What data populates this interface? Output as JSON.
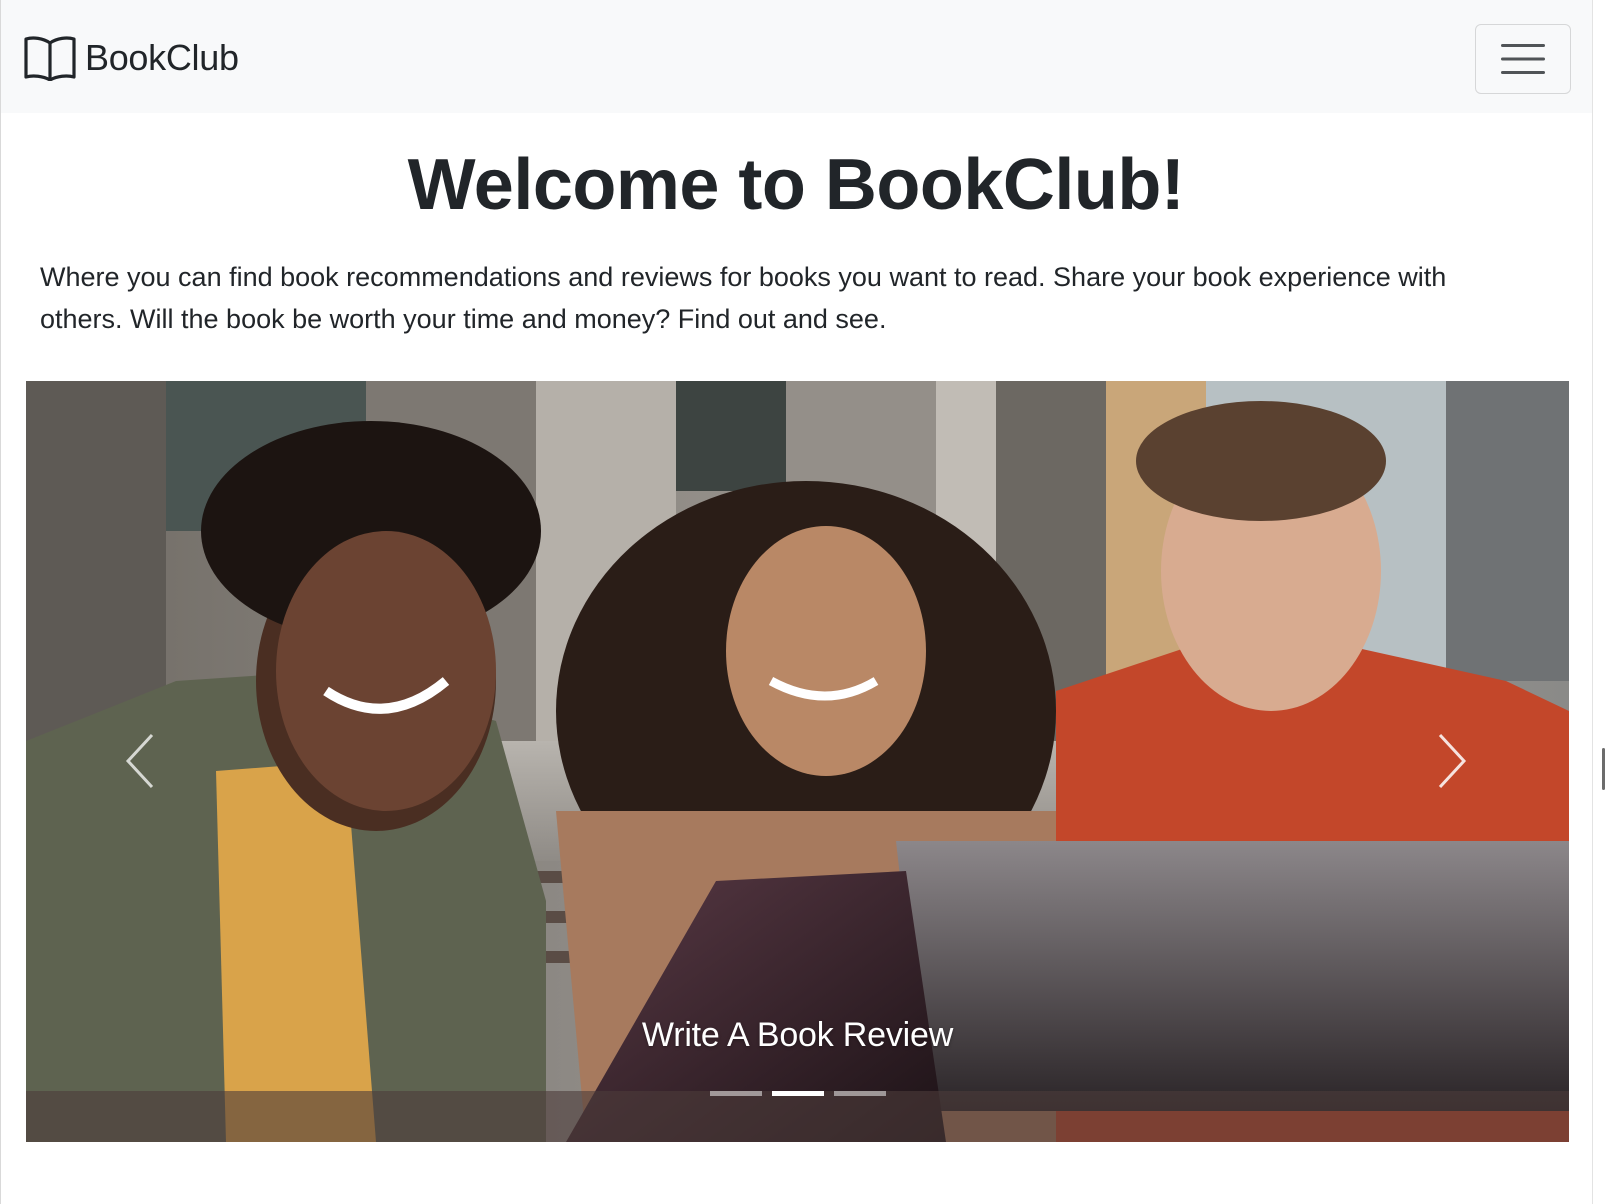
{
  "navbar": {
    "brand_icon": "book-open-icon",
    "brand_name": "BookClub",
    "toggler_icon": "hamburger-menu-icon"
  },
  "hero": {
    "title": "Welcome to BookClub!",
    "lead": "Where you can find book recommendations and reviews for books you want to read. Share your book experience with others. Will the book be worth your time and money? Find out and see."
  },
  "carousel": {
    "prev_icon": "chevron-left-icon",
    "next_icon": "chevron-right-icon",
    "active_slide": 2,
    "slide_count": 3,
    "caption": "Write A Book Review"
  },
  "colors": {
    "navbar_bg": "#f8f9fa",
    "text": "#212529",
    "caption_text": "#ffffff"
  }
}
